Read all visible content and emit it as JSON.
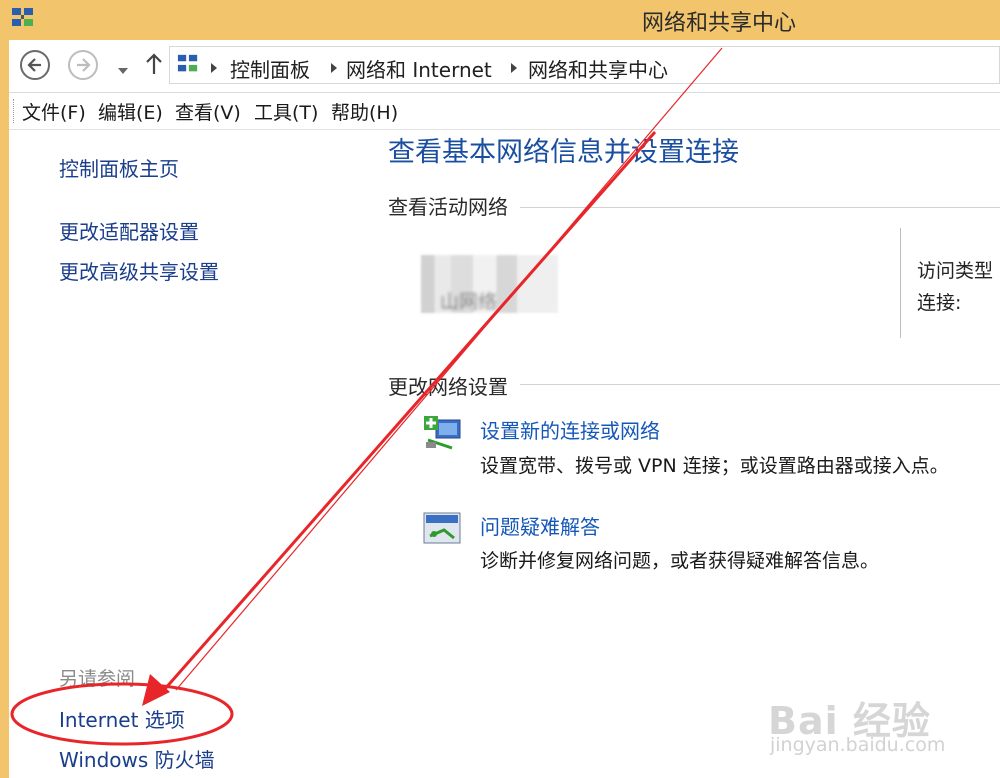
{
  "window": {
    "title": "网络和共享中心"
  },
  "address_bar": {
    "breadcrumbs": [
      "控制面板",
      "网络和 Internet",
      "网络和共享中心"
    ]
  },
  "menu": {
    "items": [
      "文件(F)",
      "编辑(E)",
      "查看(V)",
      "工具(T)",
      "帮助(H)"
    ]
  },
  "sidebar": {
    "home": "控制面板主页",
    "links": [
      "更改适配器设置",
      "更改高级共享设置"
    ],
    "see_also_heading": "另请参阅",
    "see_also": [
      "Internet 选项",
      "Windows 防火墙"
    ]
  },
  "main": {
    "title": "查看基本网络信息并设置连接",
    "active_networks_heading": "查看活动网络",
    "network_name_blurred": "山网络",
    "access_type_label": "访问类型",
    "connections_label": "连接:",
    "change_settings_heading": "更改网络设置",
    "tasks": [
      {
        "link": "设置新的连接或网络",
        "description": "设置宽带、拨号或 VPN 连接；或设置路由器或接入点。",
        "icon": "new-connection-icon"
      },
      {
        "link": "问题疑难解答",
        "description": "诊断并修复网络问题，或者获得疑难解答信息。",
        "icon": "troubleshoot-icon"
      }
    ]
  },
  "watermark": {
    "logo": "Bai 经验",
    "url": "jingyan.baidu.com"
  },
  "colors": {
    "titlebar": "#f2c56d",
    "link": "#1a3e8c",
    "title": "#1a4fa0",
    "annotation": "#e8262a"
  }
}
